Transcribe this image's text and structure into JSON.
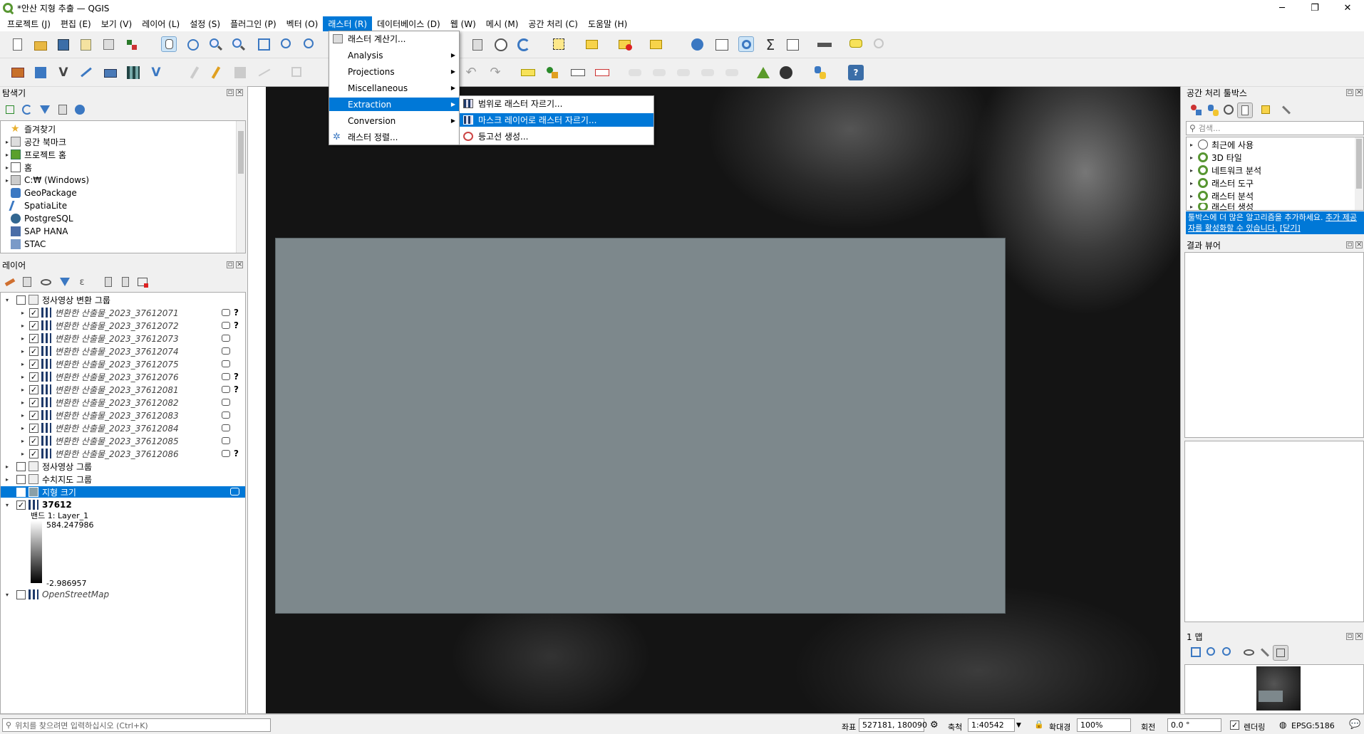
{
  "window": {
    "title": "*안산 지형 추출 — QGIS",
    "minimize": "─",
    "maximize": "❐",
    "close": "✕"
  },
  "menubar": [
    "프로젝트 (J)",
    "편집 (E)",
    "보기 (V)",
    "레이어 (L)",
    "설정 (S)",
    "플러그인 (P)",
    "벡터 (O)",
    "래스터 (R)",
    "데이터베이스 (D)",
    "웹 (W)",
    "메시 (M)",
    "공간 처리 (C)",
    "도움말 (H)"
  ],
  "raster_menu": {
    "items": [
      "래스터 계산기...",
      "Analysis",
      "Projections",
      "Miscellaneous",
      "Extraction",
      "Conversion",
      "래스터 정렬..."
    ],
    "selected": "Extraction"
  },
  "extraction_submenu": {
    "items": [
      "범위로 래스터 자르기...",
      "마스크 레이어로 래스터 자르기...",
      "등고선 생성..."
    ],
    "selected": "마스크 레이어로 래스터 자르기..."
  },
  "browser": {
    "title": "탐색기",
    "items": [
      "즐겨찾기",
      "공간 북마크",
      "프로젝트 홈",
      "홈",
      "C:₩ (Windows)",
      "GeoPackage",
      "SpatiaLite",
      "PostgreSQL",
      "SAP HANA",
      "STAC"
    ]
  },
  "layers": {
    "title": "레이어",
    "group1": "정사영상 변환 그룹",
    "sublayers": [
      "변환한 산출물_2023_37612071",
      "변환한 산출물_2023_37612072",
      "변환한 산출물_2023_37612073",
      "변환한 산출물_2023_37612074",
      "변환한 산출물_2023_37612075",
      "변환한 산출물_2023_37612076",
      "변환한 산출물_2023_37612081",
      "변환한 산출물_2023_37612082",
      "변환한 산출물_2023_37612083",
      "변환한 산출물_2023_37612084",
      "변환한 산출물_2023_37612085",
      "변환한 산출물_2023_37612086"
    ],
    "group2": "정사영상 그룹",
    "group3": "수치지도 그룹",
    "selected_layer": "지형 크기",
    "raster_layer": "37612",
    "band": "밴드 1: Layer_1",
    "legend_max": "584.247986",
    "legend_min": "-2.986957",
    "osm": "OpenStreetMap"
  },
  "toolbox": {
    "title": "공간 처리 툴박스",
    "search_placeholder": "검색...",
    "items": [
      "최근에 사용",
      "3D 타일",
      "네트워크 분석",
      "래스터 도구",
      "래스터 분석",
      "래스터 생성"
    ],
    "notice_a": "툴박스에 더 많은 알고리즘을 추가하세요.",
    "notice_link": "추가 제공자를 활성화할 수 있습니다.",
    "notice_close": "[닫기]"
  },
  "results_viewer": {
    "title": "결과 뷰어"
  },
  "overview": {
    "title": "1 맵"
  },
  "statusbar": {
    "locate_placeholder": "위치를 찾으려면 입력하십시오 (Ctrl+K)",
    "coord_label": "좌표",
    "coord_value": "527181, 180090",
    "scale_label": "축척",
    "scale_value": "1:40542",
    "magnifier_label": "확대경",
    "magnifier_value": "100%",
    "rotation_label": "회전",
    "rotation_value": "0.0 °",
    "render_label": "렌더링",
    "crs": "EPSG:5186"
  },
  "colors": {
    "accent": "#0078d7",
    "map_overlay": "#7d888c",
    "map_bg": "#1a1a1a"
  }
}
